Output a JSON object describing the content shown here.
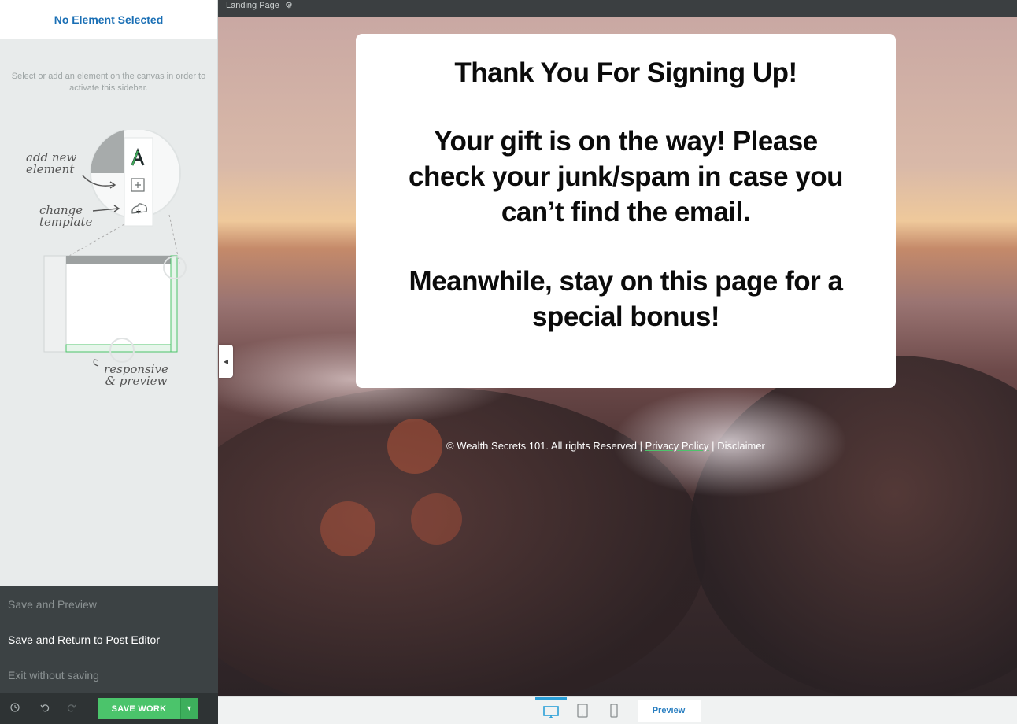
{
  "sidebar": {
    "title": "No Element Selected",
    "hint": "Select or add an element on the canvas in order to activate this sidebar.",
    "illustration": {
      "label_add": "add new element",
      "label_change": "change template",
      "label_responsive": "responsive & preview"
    },
    "menu": [
      {
        "label": "Save and Preview"
      },
      {
        "label": "Save and Return to Post Editor"
      },
      {
        "label": "Exit without saving"
      }
    ],
    "footer": {
      "save_label": "SAVE WORK",
      "icons": [
        "history-icon",
        "undo-icon",
        "redo-icon"
      ]
    }
  },
  "canvas": {
    "topbar_label": "Landing Page",
    "card_lines": [
      "Thank You For Signing Up!",
      "Your gift is on the way! Please",
      "check your junk/spam in case you",
      "can’t find the email.",
      "Meanwhile, stay on this page for a",
      "special bonus!"
    ],
    "footer": {
      "copyright": "© Wealth Secrets 101. All rights Reserved |",
      "privacy": "Privacy Policy",
      "separator": "|",
      "disclaimer": "Disclaimer"
    }
  },
  "devicebar": {
    "preview_label": "Preview",
    "devices": [
      "desktop-icon",
      "tablet-icon",
      "mobile-icon"
    ]
  },
  "colors": {
    "accent_blue": "#2a9fd8",
    "save_green": "#4bc46b",
    "title_blue": "#1a6fb5"
  }
}
